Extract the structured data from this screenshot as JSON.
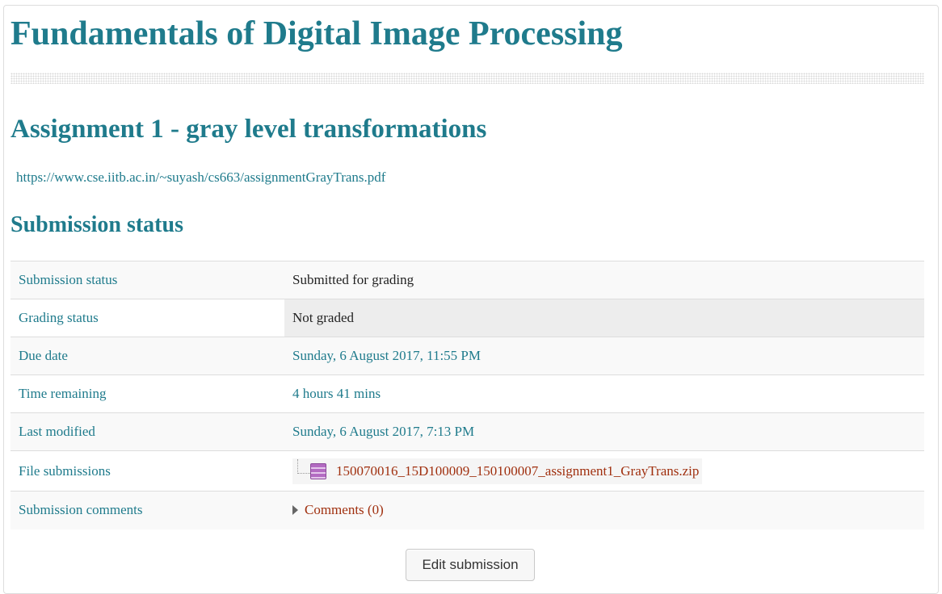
{
  "course": {
    "title": "Fundamentals of Digital Image Processing"
  },
  "assignment": {
    "title": "Assignment 1 - gray level transformations",
    "link": "https://www.cse.iitb.ac.in/~suyash/cs663/assignmentGrayTrans.pdf"
  },
  "submission": {
    "section_title": "Submission status",
    "rows": {
      "status": {
        "label": "Submission status",
        "value": "Submitted for grading"
      },
      "grading": {
        "label": "Grading status",
        "value": "Not graded"
      },
      "due": {
        "label": "Due date",
        "value": "Sunday, 6 August 2017, 11:55 PM"
      },
      "remaining": {
        "label": "Time remaining",
        "value": "4 hours 41 mins"
      },
      "modified": {
        "label": "Last modified",
        "value": "Sunday, 6 August 2017, 7:13 PM"
      },
      "files": {
        "label": "File submissions",
        "file_name": "150070016_15D100009_150100007_assignment1_GrayTrans.zip",
        "file_icon": "zip-archive-icon"
      },
      "comments": {
        "label": "Submission comments",
        "link": "Comments (0)"
      }
    },
    "edit_button": "Edit submission"
  },
  "colors": {
    "accent": "#1f7b8c",
    "link_alt": "#a0300f"
  }
}
